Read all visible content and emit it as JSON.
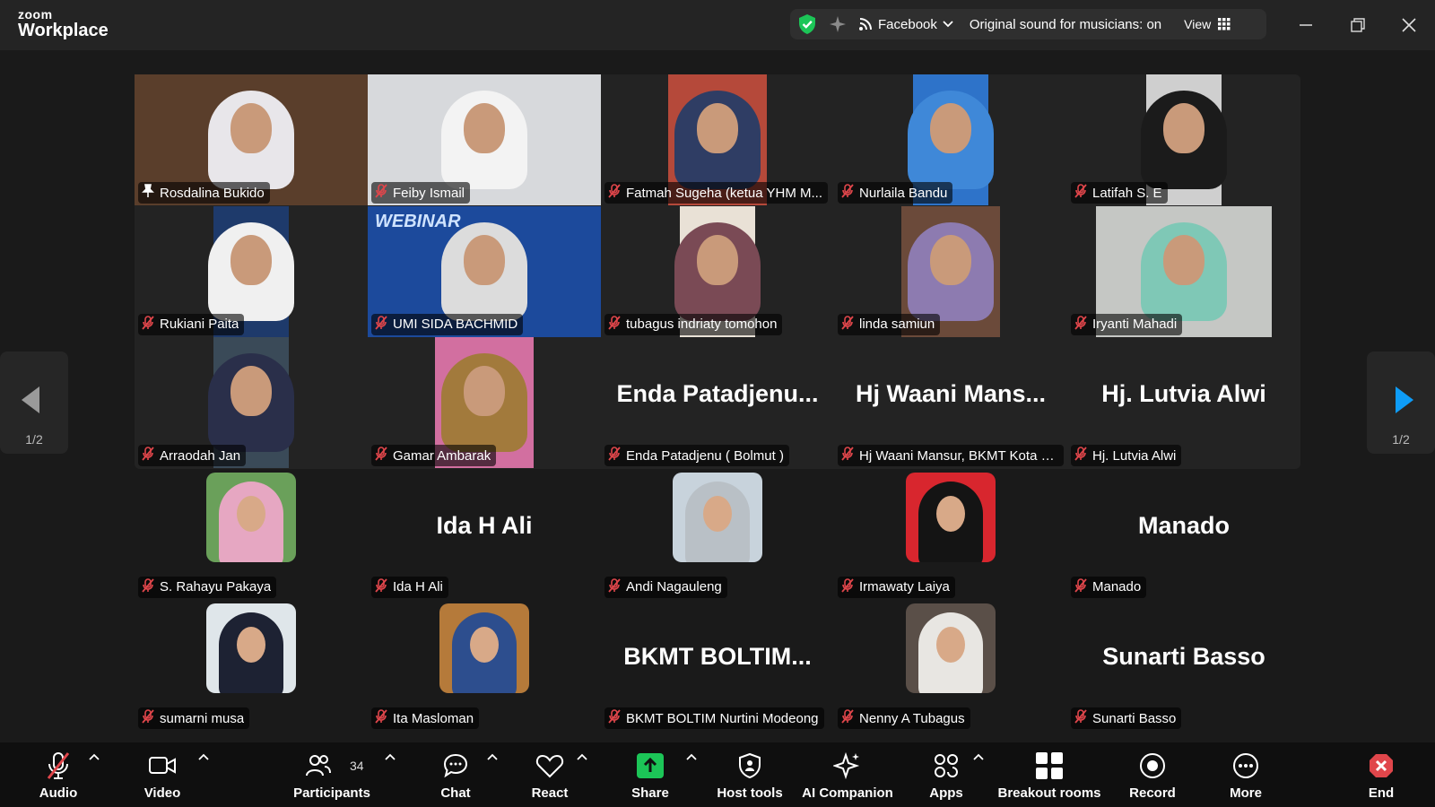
{
  "app": {
    "logo_top": "zoom",
    "logo_bottom": "Workplace"
  },
  "topbar": {
    "stream_target": "Facebook",
    "original_sound": "Original sound for musicians: on",
    "view_label": "View"
  },
  "colors": {
    "accent_green": "#1cc557",
    "muted_red": "#e0464b",
    "share_green": "#1cc557",
    "nav_blue": "#0e9cf7"
  },
  "pager": {
    "left": "1/2",
    "right": "1/2"
  },
  "participants": [
    {
      "name": "Rosdalina Bukido",
      "kind": "video",
      "pinned": true,
      "bg": "#5a3e2b",
      "scarf": "#e8e6ea"
    },
    {
      "name": "Feiby Ismail",
      "kind": "video",
      "bg": "#d7d9dc",
      "scarf": "#f3f3f3"
    },
    {
      "name": "Fatmah Sugeha (ketua YHM M...",
      "kind": "video",
      "bg": "#b5493a",
      "scarf": "#2f3d64"
    },
    {
      "name": "Nurlaila Bandu",
      "kind": "video",
      "bg": "#2e73c9",
      "scarf": "#3f88d8"
    },
    {
      "name": "Latifah S. E",
      "kind": "video",
      "bg": "#cfcfcf",
      "scarf": "#1b1b1b"
    },
    {
      "name": "Rukiani Paita",
      "kind": "video",
      "bg": "#1e3a6b",
      "scarf": "#f0f0f0"
    },
    {
      "name": "UMI SIDA BACHMID",
      "kind": "video",
      "bg": "#1c4a9c",
      "scarf": "#dcdcdc",
      "banner": "WEBINAR"
    },
    {
      "name": "tubagus indriaty tomohon",
      "kind": "video",
      "bg": "#e9e1d6",
      "scarf": "#7a4a55"
    },
    {
      "name": "linda samiun",
      "kind": "video",
      "bg": "#6b4a3a",
      "scarf": "#8d7bb0"
    },
    {
      "name": "Iryanti Mahadi",
      "kind": "video",
      "bg": "#c5c7c4",
      "scarf": "#7fc8b6"
    },
    {
      "name": "Arraodah Jan",
      "kind": "video",
      "bg": "#3a4a58",
      "scarf": "#2a2f4a"
    },
    {
      "name": "Gamar Ambarak",
      "kind": "video",
      "bg": "#d26fa0",
      "scarf": "#a27a3c"
    },
    {
      "name": "Enda Patadjenu ( Bolmut )",
      "kind": "name",
      "big": "Enda  Patadjenu..."
    },
    {
      "name": "Hj Waani Mansur, BKMT Kota B...",
      "kind": "name",
      "big": "Hj  Waani  Mans..."
    },
    {
      "name": "Hj. Lutvia Alwi",
      "kind": "name",
      "big": "Hj. Lutvia Alwi"
    },
    {
      "name": "S. Rahayu Pakaya",
      "kind": "avatar",
      "bg": "#6aa05a",
      "scarf": "#e6a7c2"
    },
    {
      "name": "Ida H Ali",
      "kind": "name",
      "big": "Ida H Ali"
    },
    {
      "name": "Andi Nagauleng",
      "kind": "avatar",
      "bg": "#c8d3dc",
      "scarf": "#b9c0c6"
    },
    {
      "name": "Irmawaty Laiya",
      "kind": "avatar",
      "bg": "#d8262e",
      "scarf": "#141414"
    },
    {
      "name": "Manado",
      "kind": "name",
      "big": "Manado"
    },
    {
      "name": "sumarni musa",
      "kind": "avatar",
      "bg": "#dfe6ea",
      "scarf": "#1d2233"
    },
    {
      "name": "Ita Masloman",
      "kind": "avatar",
      "bg": "#b57a3a",
      "scarf": "#2d4e8e"
    },
    {
      "name": "BKMT BOLTIM Nurtini Modeong",
      "kind": "name",
      "big": "BKMT  BOLTIM..."
    },
    {
      "name": "Nenny A Tubagus",
      "kind": "avatar",
      "bg": "#5a4f48",
      "scarf": "#e8e6e2"
    },
    {
      "name": "Sunarti Basso",
      "kind": "name",
      "big": "Sunarti Basso"
    }
  ],
  "toolbar": {
    "audio": "Audio",
    "video": "Video",
    "participants": "Participants",
    "participants_count": "34",
    "chat": "Chat",
    "react": "React",
    "share": "Share",
    "host_tools": "Host tools",
    "ai_companion": "AI Companion",
    "apps": "Apps",
    "breakout_rooms": "Breakout rooms",
    "record": "Record",
    "more": "More",
    "end": "End"
  }
}
